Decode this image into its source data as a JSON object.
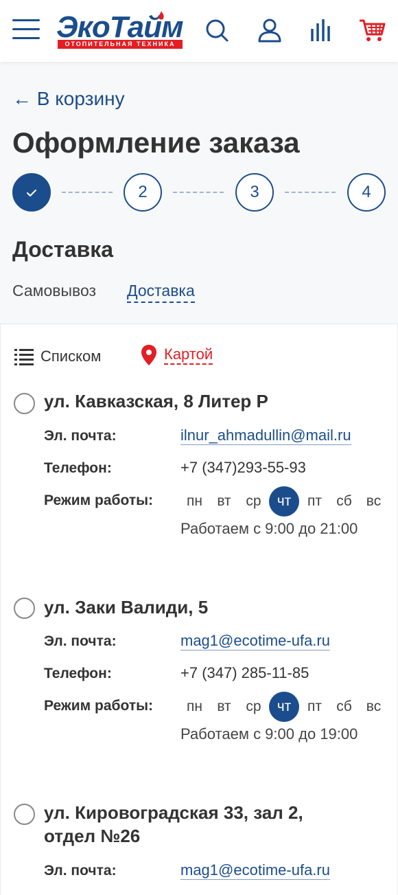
{
  "header": {
    "logo_text": "ЭкоТайм",
    "logo_subtitle": "ОТОПИТЕЛЬНАЯ ТЕХНИКА",
    "icons": [
      "menu-icon",
      "search-icon",
      "user-icon",
      "compare-icon",
      "cart-icon"
    ],
    "brand_color": "#1b4d8c",
    "accent_color": "#e31e24"
  },
  "back_link": "← В корзину",
  "page_title": "Оформление заказа",
  "steps": [
    {
      "label": "",
      "state": "done"
    },
    {
      "label": "2",
      "state": "pending"
    },
    {
      "label": "3",
      "state": "pending"
    },
    {
      "label": "4",
      "state": "pending"
    }
  ],
  "section_title": "Доставка",
  "delivery_options": {
    "pickup": "Самовывоз",
    "delivery": "Доставка"
  },
  "view_toggle": {
    "list": "Списком",
    "map": "Картой"
  },
  "labels": {
    "email": "Эл. почта:",
    "phone": "Телефон:",
    "hours": "Режим работы:"
  },
  "days": [
    "пн",
    "вт",
    "ср",
    "чт",
    "пт",
    "сб",
    "вс"
  ],
  "stores": [
    {
      "name": "ул. Кавказская, 8 Литер Р",
      "email": "ilnur_ahmadullin@mail.ru",
      "phone": "+7 (347)293-55-93",
      "today": "чт",
      "hours": "Работаем с 9:00 до 21:00"
    },
    {
      "name": "ул. Заки Валиди, 5",
      "email": "mag1@ecotime-ufa.ru",
      "phone": "+7 (347) 285-11-85",
      "today": "чт",
      "hours": "Работаем с 9:00 до 19:00"
    },
    {
      "name": "ул. Кировоградская 33, зал 2, отдел №26",
      "email": "mag1@ecotime-ufa.ru"
    }
  ]
}
